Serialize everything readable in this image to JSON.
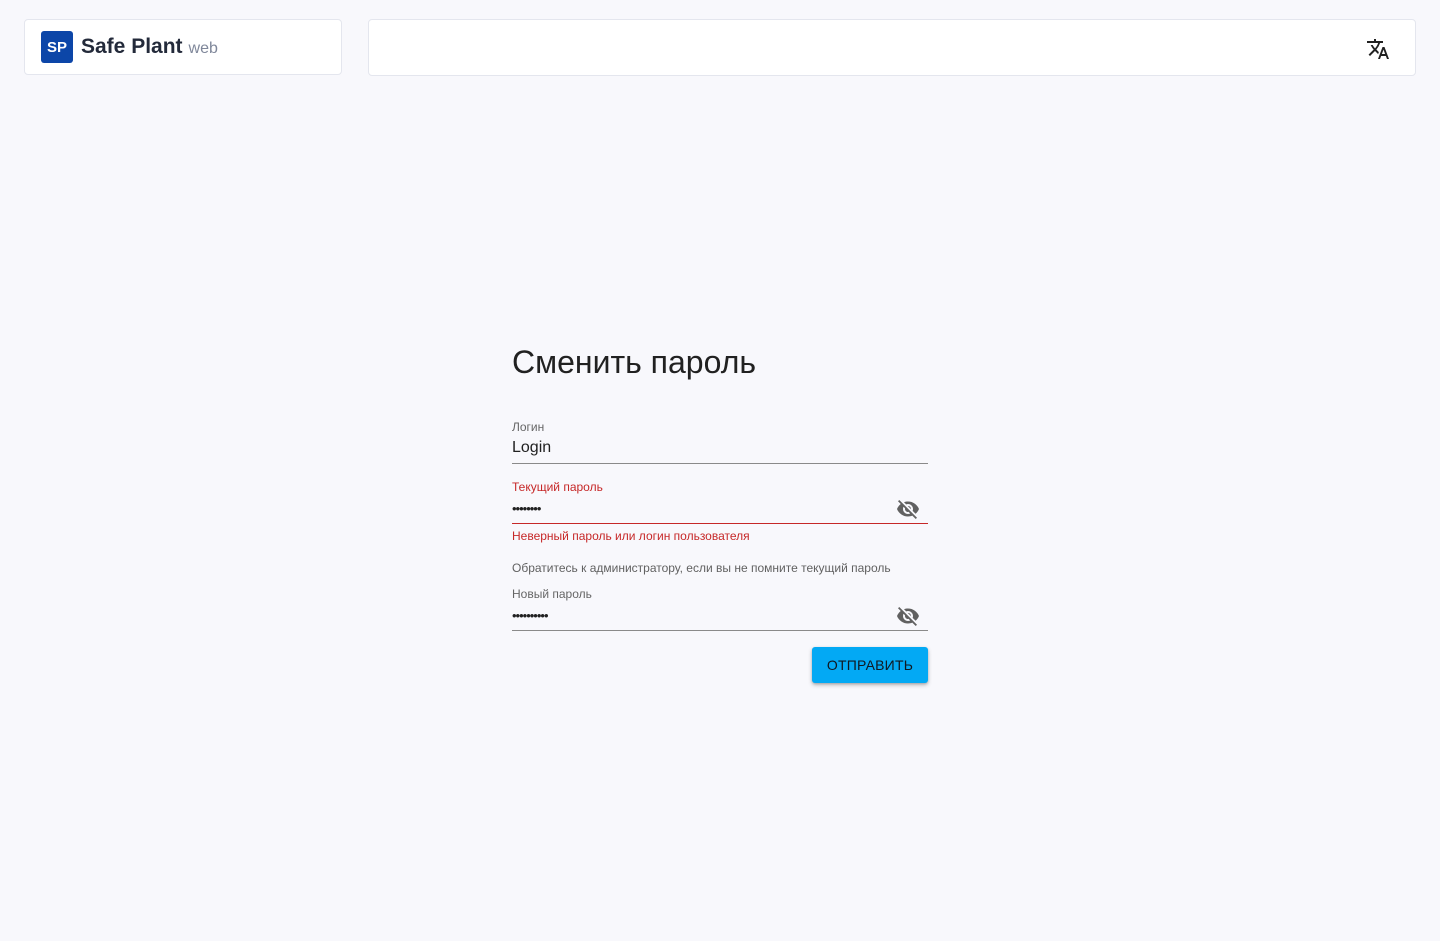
{
  "brand": {
    "logo_text": "SP",
    "name": "Safe Plant",
    "suffix": "web"
  },
  "header": {
    "language_icon": "translate-icon"
  },
  "form": {
    "title": "Сменить пароль",
    "login": {
      "label": "Логин",
      "value": "Login"
    },
    "current_password": {
      "label": "Текущий пароль",
      "masked_value": "••••••••",
      "visibility_icon": "eye-off-icon",
      "error": "Неверный пароль или логин пользователя"
    },
    "hint": "Обратитесь к администратору, если вы не помните текущий пароль",
    "new_password": {
      "label": "Новый пароль",
      "masked_value": "••••••••••",
      "visibility_icon": "eye-off-icon"
    },
    "submit_label": "ОТПРАВИТЬ"
  },
  "colors": {
    "background": "#f8f8fc",
    "brand": "#0c46a8",
    "accent": "#03a9f4",
    "error": "#c62828"
  }
}
